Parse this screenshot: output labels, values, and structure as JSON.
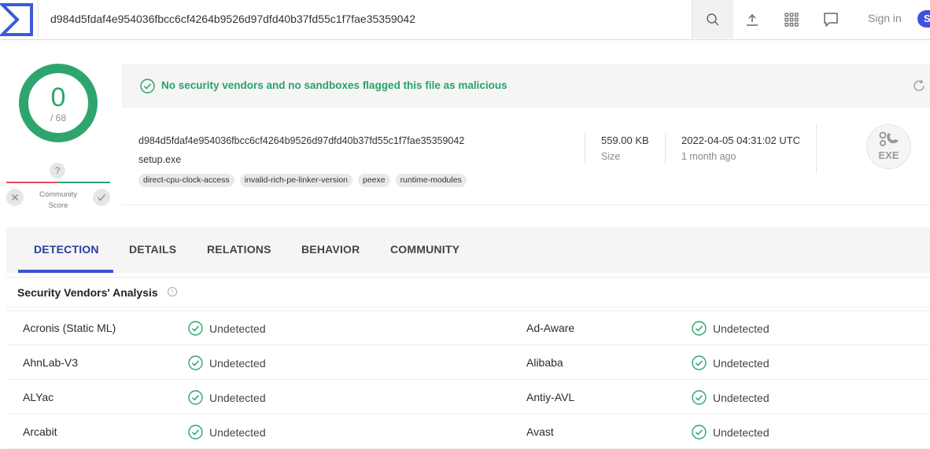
{
  "search": {
    "value": "d984d5fdaf4e954036fbcc6cf4264b9526d97dfd40b37fd55c1f7fae35359042"
  },
  "header": {
    "signin_label": "Sign in",
    "signup_label": "S"
  },
  "score": {
    "value": "0",
    "total": "/ 68",
    "community_label": "Community",
    "community_sub": "Score",
    "community_value": "?"
  },
  "summary": {
    "banner": "No security vendors and no sandboxes flagged this file as malicious",
    "hash": "d984d5fdaf4e954036fbcc6cf4264b9526d97dfd40b37fd55c1f7fae35359042",
    "filename": "setup.exe",
    "tags": [
      "direct-cpu-clock-access",
      "invalid-rich-pe-linker-version",
      "peexe",
      "runtime-modules"
    ],
    "size": "559.00 KB",
    "size_label": "Size",
    "date": "2022-04-05 04:31:02 UTC",
    "date_ago": "1 month ago",
    "filetype": "EXE"
  },
  "tabs": [
    "DETECTION",
    "DETAILS",
    "RELATIONS",
    "BEHAVIOR",
    "COMMUNITY"
  ],
  "analysis": {
    "title": "Security Vendors' Analysis",
    "rows": [
      {
        "left_vendor": "Acronis (Static ML)",
        "left_status": "Undetected",
        "right_vendor": "Ad-Aware",
        "right_status": "Undetected"
      },
      {
        "left_vendor": "AhnLab-V3",
        "left_status": "Undetected",
        "right_vendor": "Alibaba",
        "right_status": "Undetected"
      },
      {
        "left_vendor": "ALYac",
        "left_status": "Undetected",
        "right_vendor": "Antiy-AVL",
        "right_status": "Undetected"
      },
      {
        "left_vendor": "Arcabit",
        "left_status": "Undetected",
        "right_vendor": "Avast",
        "right_status": "Undetected"
      }
    ]
  },
  "colors": {
    "accent": "#3a54d6",
    "clean": "#2ea56f",
    "banner_text": "#27a36a"
  }
}
